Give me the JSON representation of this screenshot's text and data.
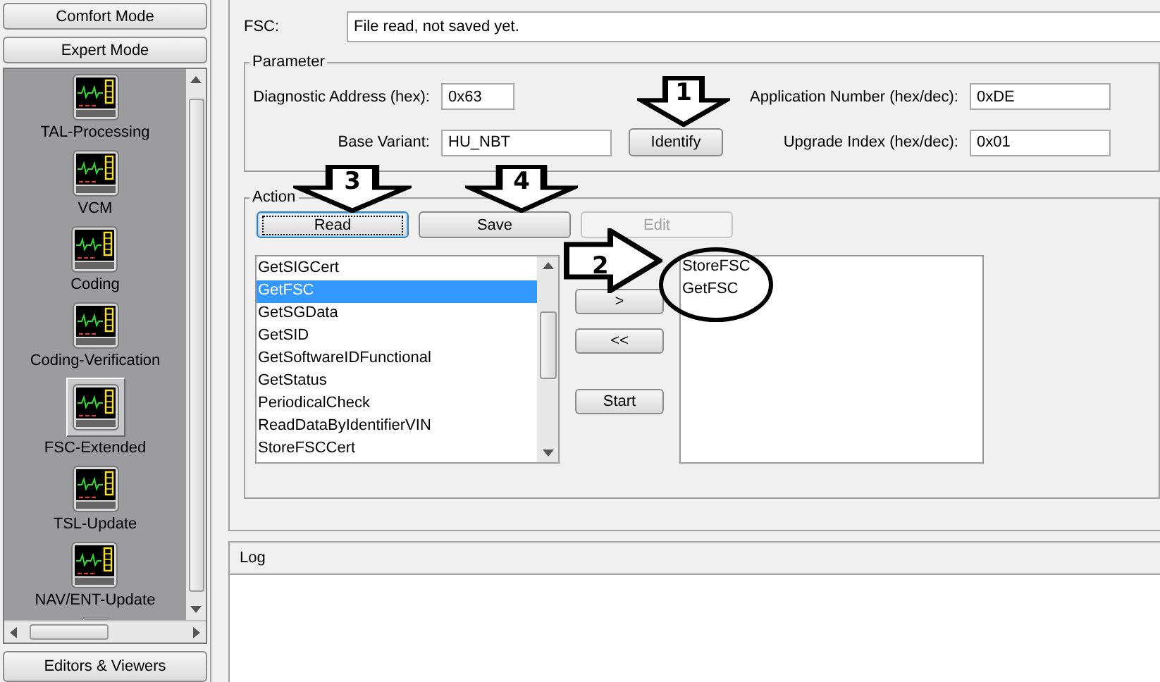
{
  "sidebar": {
    "mode_buttons": [
      {
        "label": "Comfort Mode"
      },
      {
        "label": "Expert Mode"
      }
    ],
    "items": [
      {
        "label": "TAL-Processing",
        "selected": false
      },
      {
        "label": "VCM",
        "selected": false
      },
      {
        "label": "Coding",
        "selected": false
      },
      {
        "label": "Coding-Verification",
        "selected": false
      },
      {
        "label": "FSC-Extended",
        "selected": true
      },
      {
        "label": "TSL-Update",
        "selected": false
      },
      {
        "label": "NAV/ENT-Update",
        "selected": false
      }
    ],
    "cut_off_item": true,
    "bottom_button": {
      "label": "Editors & Viewers"
    }
  },
  "fsc": {
    "label": "FSC:",
    "value": "File read, not saved yet."
  },
  "parameter": {
    "title": "Parameter",
    "fields": [
      {
        "label": "Diagnostic Address (hex):",
        "value": "0x63"
      },
      {
        "label": "Application Number (hex/dec):",
        "value": "0xDE"
      },
      {
        "label": "Base Variant:",
        "value": "HU_NBT"
      },
      {
        "label": "Upgrade Index (hex/dec):",
        "value": "0x01"
      }
    ],
    "identify_button": "Identify"
  },
  "action": {
    "title": "Action",
    "buttons": [
      {
        "label": "Read",
        "focused": true,
        "disabled": false
      },
      {
        "label": "Save",
        "focused": false,
        "disabled": false
      },
      {
        "label": "Edit",
        "focused": false,
        "disabled": true
      }
    ],
    "functions": [
      {
        "label": "GetSIGCert",
        "selected": false
      },
      {
        "label": "GetFSC",
        "selected": true
      },
      {
        "label": "GetSGData",
        "selected": false
      },
      {
        "label": "GetSID",
        "selected": false
      },
      {
        "label": "GetSoftwareIDFunctional",
        "selected": false
      },
      {
        "label": "GetStatus",
        "selected": false
      },
      {
        "label": "PeriodicalCheck",
        "selected": false
      },
      {
        "label": "ReadDataByIdentifierVIN",
        "selected": false
      },
      {
        "label": "StoreFSCCert",
        "selected": false
      }
    ],
    "move_buttons": [
      ">",
      "<<",
      "Start"
    ],
    "queue": [
      "StoreFSC",
      "GetFSC"
    ]
  },
  "log": {
    "title": "Log"
  },
  "annotations": [
    {
      "kind": "down-arrow",
      "number": "1"
    },
    {
      "kind": "down-arrow",
      "number": "3"
    },
    {
      "kind": "down-arrow",
      "number": "4"
    },
    {
      "kind": "right-arrow",
      "number": "2"
    },
    {
      "kind": "circle"
    }
  ]
}
